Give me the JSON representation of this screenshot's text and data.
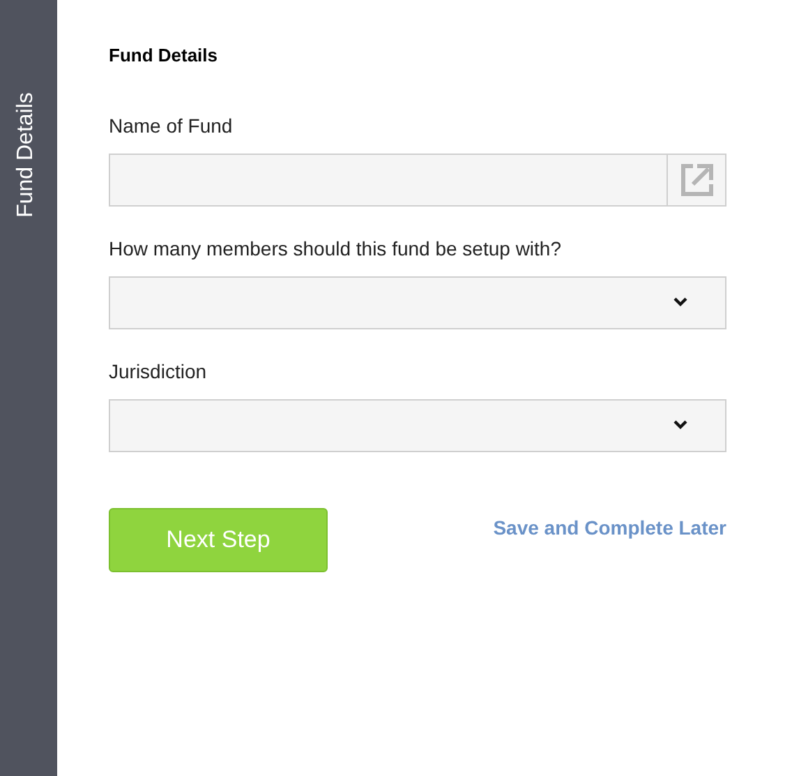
{
  "sidebar": {
    "label": "Fund Details"
  },
  "heading": "Fund Details",
  "fields": [
    {
      "kind": "lookup",
      "label": "Name of Fund"
    },
    {
      "kind": "select",
      "label": "How many members should this fund be setup with?"
    },
    {
      "kind": "select",
      "label": "Jurisdiction"
    }
  ],
  "actions": {
    "next": "Next Step",
    "save_later": "Save and Complete Later"
  }
}
